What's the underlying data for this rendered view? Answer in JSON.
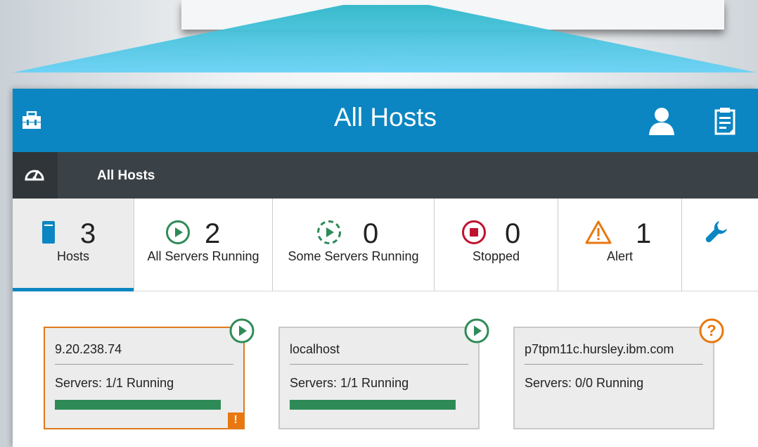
{
  "header": {
    "title": "All Hosts",
    "left_icon": "toolbox-icon",
    "right_icons": [
      "user-icon",
      "notes-icon"
    ],
    "color": "#0b86c2"
  },
  "nav": {
    "icon": "dashboard-gauge-icon",
    "label": "All Hosts"
  },
  "tabs": [
    {
      "count": "3",
      "label": "Hosts",
      "icon": "server-icon",
      "active": true
    },
    {
      "count": "2",
      "label": "All Servers Running",
      "icon": "play-circle-icon"
    },
    {
      "count": "0",
      "label": "Some Servers Running",
      "icon": "play-dashed-circle-icon"
    },
    {
      "count": "0",
      "label": "Stopped",
      "icon": "stop-circle-icon"
    },
    {
      "count": "1",
      "label": "Alert",
      "icon": "warning-triangle-icon"
    },
    {
      "label": "",
      "icon": "wrench-icon"
    }
  ],
  "cards": [
    {
      "host": "9.20.238.74",
      "servers": "Servers: 1/1 Running",
      "progress": 1.0,
      "status": "running",
      "alert": "!"
    },
    {
      "host": "localhost",
      "servers": "Servers: 1/1 Running",
      "progress": 1.0,
      "status": "running"
    },
    {
      "host": "p7tpm11c.hursley.ibm.com",
      "servers": "Servers: 0/0 Running",
      "status": "unknown"
    }
  ],
  "colors": {
    "running": "#2e8b57",
    "stopped": "#c0122f",
    "alert": "#e8780f",
    "accent": "#0b86c2"
  }
}
